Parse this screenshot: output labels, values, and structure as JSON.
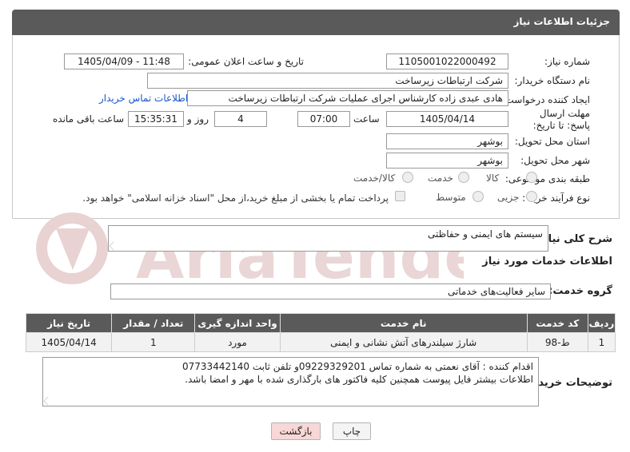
{
  "header": {
    "title": "جزئیات اطلاعات نیاز"
  },
  "form": {
    "need_number_label": "شماره نیاز:",
    "need_number": "1105001022000492",
    "announce_label": "تاریخ و ساعت اعلان عمومی:",
    "announce_value": "1405/04/09 - 11:48",
    "buyer_org_label": "نام دستگاه خریدار:",
    "buyer_org": "شرکت ارتباطات زیرساخت",
    "requester_label": "ایجاد کننده درخواست:",
    "requester": "هادی عبدی زاده کارشناس اجرای عملیات شرکت ارتباطات زیرساخت",
    "contact_link": "اطلاعات تماس خریدار",
    "deadline_label": "مهلت ارسال پاسخ: تا تاریخ:",
    "deadline_date": "1405/04/14",
    "hour_label": "ساعت",
    "deadline_time": "07:00",
    "days_value": "4",
    "days_label": "روز و",
    "remaining_time": "15:35:31",
    "remaining_label": "ساعت باقی مانده",
    "province_label": "استان محل تحویل:",
    "province": "بوشهر",
    "city_label": "شهر محل تحویل:",
    "city": "بوشهر",
    "category_label": "طبقه بندی موضوعی:",
    "category_options": [
      "کالا",
      "خدمت",
      "کالا/خدمت"
    ],
    "process_label": "نوع فرآیند خرید :",
    "process_options": [
      "جزیی",
      "متوسط"
    ],
    "payment_note": "پرداخت تمام یا بخشی از مبلغ خرید،از محل \"اسناد خزانه اسلامی\" خواهد بود."
  },
  "summary": {
    "label": "شرح کلی نیاز:",
    "value": "سیستم های ایمنی و حفاظتی"
  },
  "services_info": {
    "title": "اطلاعات خدمات مورد نیاز"
  },
  "service_group": {
    "label": "گروه خدمت:",
    "value": "سایر فعالیت‌های خدماتی"
  },
  "table": {
    "headers": [
      "ردیف",
      "کد خدمت",
      "نام خدمت",
      "واحد اندازه گیری",
      "تعداد / مقدار",
      "تاریخ نیاز"
    ],
    "rows": [
      [
        "1",
        "ط-98",
        "شارژ سیلندرهای آتش نشانی و ایمنی",
        "مورد",
        "1",
        "1405/04/14"
      ]
    ]
  },
  "buyer_notes": {
    "label": "توضیحات خریدار:",
    "line1": "اقدام کننده : آقای نعمتی  به شماره تماس 09229329201و تلفن ثابت 07733442140",
    "line2": "اطلاعات بیشتر فایل پیوست همچنین کلیه فاکتور های بارگذاری شده با مهر و امضا باشد."
  },
  "buttons": {
    "print": "چاپ",
    "back": "بازگشت"
  },
  "watermark": {
    "text": "AriaTender.net"
  },
  "colors": {
    "header": "#5a5a5a",
    "link": "#1a56c9",
    "back_button": "#f8d7d7",
    "watermark": "#e3c9c9"
  }
}
